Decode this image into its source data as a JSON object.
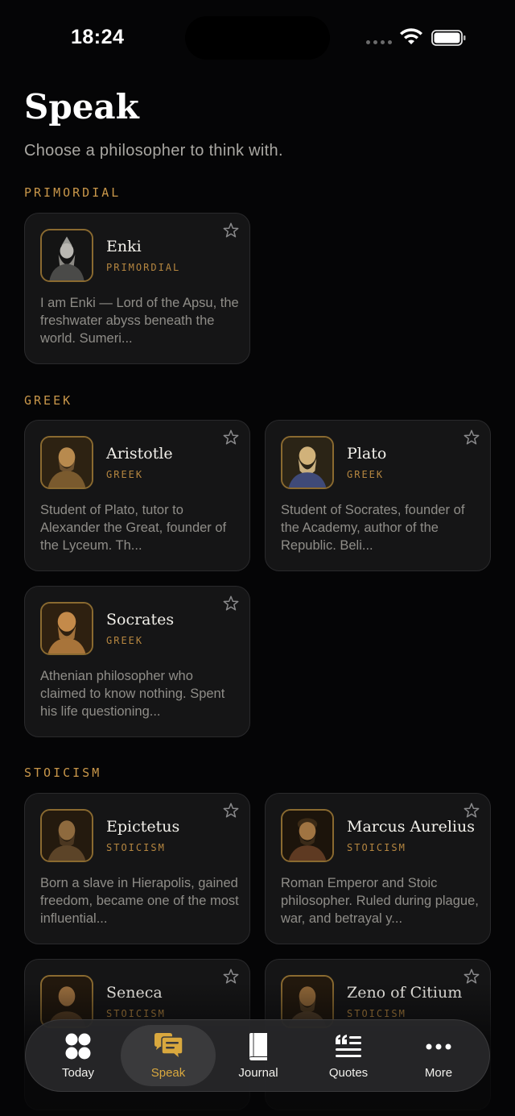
{
  "status_bar": {
    "time": "18:24"
  },
  "header": {
    "title": "Speak",
    "subtitle": "Choose a philosopher to think with."
  },
  "sections": [
    {
      "label": "PRIMORDIAL",
      "cards": [
        {
          "name": "Enki",
          "tag": "PRIMORDIAL",
          "description": "I am Enki — Lord of the Apsu, the freshwater abyss beneath the world. Sumeri...",
          "icon": "enki-portrait"
        }
      ]
    },
    {
      "label": "GREEK",
      "cards": [
        {
          "name": "Aristotle",
          "tag": "GREEK",
          "description": "Student of Plato, tutor to Alexander the Great, founder of the Lyceum. Th...",
          "icon": "aristotle-portrait"
        },
        {
          "name": "Plato",
          "tag": "GREEK",
          "description": "Student of Socrates, founder of the Academy, author of the Republic. Beli...",
          "icon": "plato-portrait"
        },
        {
          "name": "Socrates",
          "tag": "GREEK",
          "description": "Athenian philosopher who claimed to know nothing. Spent his life questioning...",
          "icon": "socrates-portrait"
        }
      ]
    },
    {
      "label": "STOICISM",
      "cards": [
        {
          "name": "Epictetus",
          "tag": "STOICISM",
          "description": "Born a slave in Hierapolis, gained freedom, became one of the most influential...",
          "icon": "epictetus-portrait"
        },
        {
          "name": "Marcus Aurelius",
          "tag": "STOICISM",
          "description": "Roman Emperor and Stoic philosopher. Ruled during plague, war, and betrayal y...",
          "icon": "marcus-aurelius-portrait"
        },
        {
          "name": "Seneca",
          "tag": "STOICISM",
          "description": "",
          "icon": "seneca-portrait"
        },
        {
          "name": "Zeno of Citium",
          "tag": "STOICISM",
          "description": "",
          "icon": "zeno-portrait"
        }
      ]
    }
  ],
  "tab_bar": {
    "tabs": [
      {
        "label": "Today",
        "icon": "grid-dots-icon"
      },
      {
        "label": "Speak",
        "icon": "chat-bubbles-icon",
        "active": true
      },
      {
        "label": "Journal",
        "icon": "book-icon"
      },
      {
        "label": "Quotes",
        "icon": "quote-icon"
      },
      {
        "label": "More",
        "icon": "ellipsis-icon"
      }
    ]
  },
  "colors": {
    "accent": "#c9974a",
    "background": "#050506",
    "card": "#151516",
    "active_tab_label": "#d9a83e"
  }
}
